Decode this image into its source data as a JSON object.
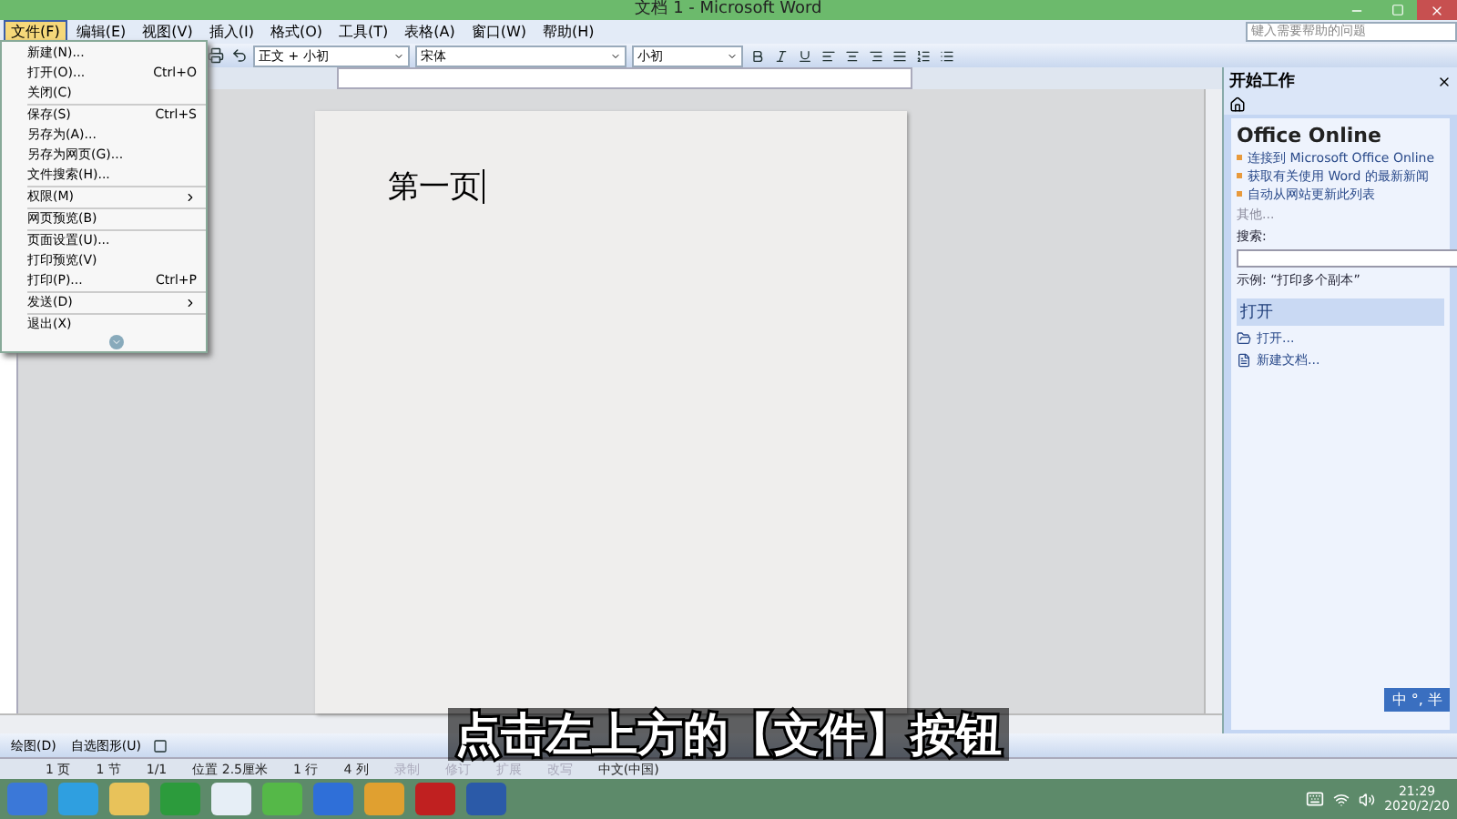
{
  "window": {
    "title": "文档 1 - Microsoft Word"
  },
  "menus": [
    {
      "label": "文件(F)",
      "selected": true
    },
    {
      "label": "编辑(E)",
      "selected": false
    },
    {
      "label": "视图(V)",
      "selected": false
    },
    {
      "label": "插入(I)",
      "selected": false
    },
    {
      "label": "格式(O)",
      "selected": false
    },
    {
      "label": "工具(T)",
      "selected": false
    },
    {
      "label": "表格(A)",
      "selected": false
    },
    {
      "label": "窗口(W)",
      "selected": false
    },
    {
      "label": "帮助(H)",
      "selected": false
    }
  ],
  "help_box": {
    "placeholder": "键入需要帮助的问题"
  },
  "toolbar": {
    "style": "正文 + 小初",
    "font": "宋体",
    "size": "小初"
  },
  "file_menu": [
    {
      "label": "新建(N)...",
      "submenu": false,
      "separator_before": false
    },
    {
      "label": "打开(O)...",
      "shortcut": "Ctrl+O",
      "submenu": false,
      "separator_before": false
    },
    {
      "label": "关闭(C)",
      "submenu": false,
      "separator_before": false
    },
    {
      "label": "保存(S)",
      "shortcut": "Ctrl+S",
      "submenu": false,
      "separator_before": true
    },
    {
      "label": "另存为(A)...",
      "submenu": false,
      "separator_before": false
    },
    {
      "label": "另存为网页(G)...",
      "submenu": false,
      "separator_before": false
    },
    {
      "label": "文件搜索(H)...",
      "submenu": false,
      "separator_before": false
    },
    {
      "label": "权限(M)",
      "submenu": true,
      "separator_before": true
    },
    {
      "label": "网页预览(B)",
      "submenu": false,
      "separator_before": true
    },
    {
      "label": "页面设置(U)...",
      "submenu": false,
      "separator_before": true
    },
    {
      "label": "打印预览(V)",
      "submenu": false,
      "separator_before": false
    },
    {
      "label": "打印(P)...",
      "shortcut": "Ctrl+P",
      "submenu": false,
      "separator_before": false
    },
    {
      "label": "发送(D)",
      "submenu": true,
      "separator_before": true
    },
    {
      "label": "退出(X)",
      "submenu": false,
      "separator_before": true
    }
  ],
  "document": {
    "text": "第一页"
  },
  "task_pane": {
    "title": "开始工作",
    "brand": "Office Online",
    "links": [
      "连接到 Microsoft Office Online",
      "获取有关使用 Word 的最新新闻",
      "自动从网站更新此列表"
    ],
    "more": "其他...",
    "search_label": "搜索:",
    "example": "示例: “打印多个副本”",
    "open_section": "打开",
    "open_items": [
      "打开...",
      "新建文档..."
    ]
  },
  "ime": {
    "text": "中 °, 半"
  },
  "caption": "点击左上方的【文件】按钮",
  "draw_toolbar": {
    "draw": "绘图(D)",
    "autoshapes": "自选图形(U)"
  },
  "status_bar": [
    {
      "text": "1 页",
      "disabled": false
    },
    {
      "text": "1 节",
      "disabled": false
    },
    {
      "text": "1/1",
      "disabled": false
    },
    {
      "text": "位置 2.5厘米",
      "disabled": false
    },
    {
      "text": "1 行",
      "disabled": false
    },
    {
      "text": "4 列",
      "disabled": false
    },
    {
      "text": "录制",
      "disabled": true
    },
    {
      "text": "修订",
      "disabled": true
    },
    {
      "text": "扩展",
      "disabled": true
    },
    {
      "text": "改写",
      "disabled": true
    },
    {
      "text": "中文(中国)",
      "disabled": false
    }
  ],
  "clock": {
    "time": "21:29",
    "date": "2020/2/20"
  }
}
